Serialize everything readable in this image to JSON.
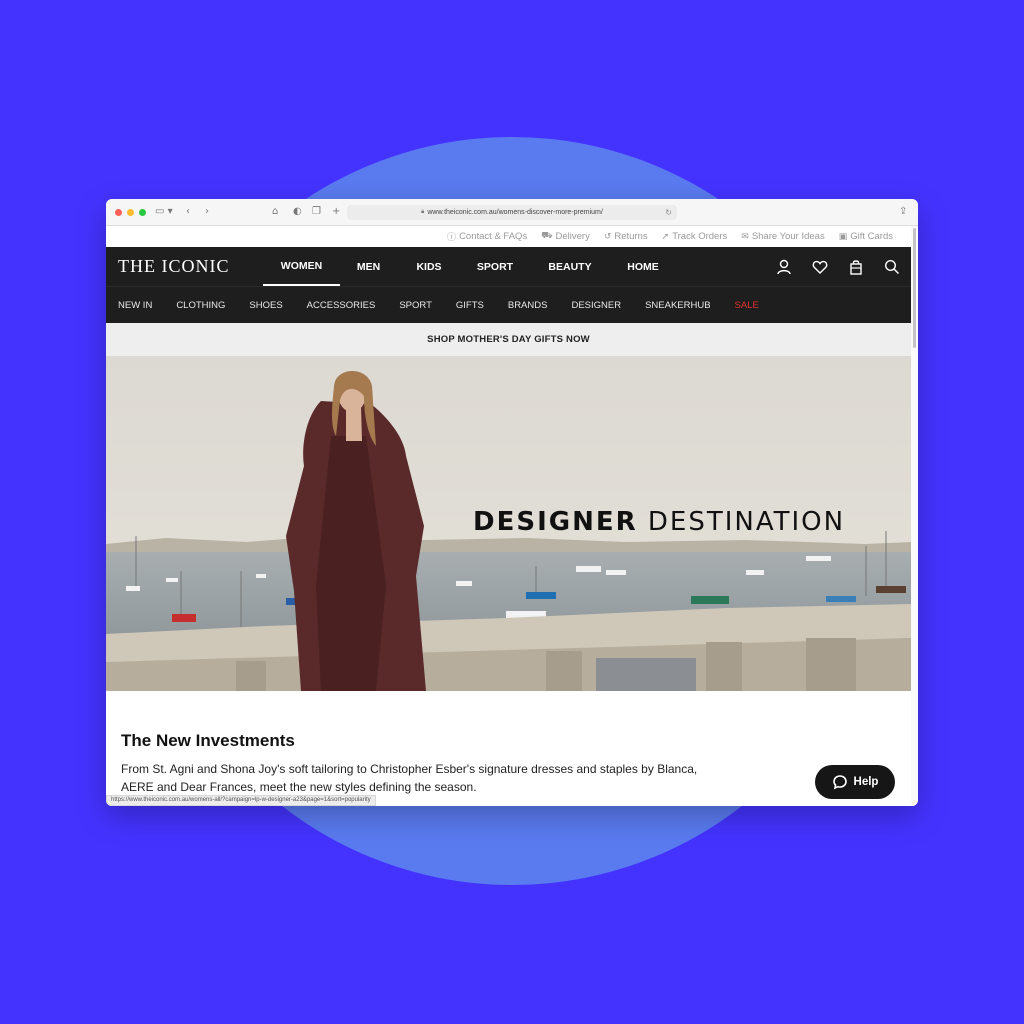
{
  "browser": {
    "url": "www.theiconic.com.au/womens-discover-more-premium/",
    "status_url": "https://www.theiconic.com.au/womens-all/?campaign=lp-w-designer-a23&page=1&sort=popularity"
  },
  "utility_links": [
    {
      "label": "Contact & FAQs",
      "icon": "help-circle-icon"
    },
    {
      "label": "Delivery",
      "icon": "truck-icon"
    },
    {
      "label": "Returns",
      "icon": "return-icon"
    },
    {
      "label": "Track Orders",
      "icon": "send-icon"
    },
    {
      "label": "Share Your Ideas",
      "icon": "megaphone-icon"
    },
    {
      "label": "Gift Cards",
      "icon": "gift-card-icon"
    }
  ],
  "header": {
    "logo": "THE ICONIC",
    "tabs": [
      "WOMEN",
      "MEN",
      "KIDS",
      "SPORT",
      "BEAUTY",
      "HOME"
    ],
    "active_tab": "WOMEN",
    "icons": [
      "account-icon",
      "wishlist-heart-icon",
      "shopping-bag-icon",
      "search-icon"
    ]
  },
  "subnav": [
    "NEW IN",
    "CLOTHING",
    "SHOES",
    "ACCESSORIES",
    "SPORT",
    "GIFTS",
    "BRANDS",
    "DESIGNER",
    "SNEAKERHUB",
    "SALE"
  ],
  "promo_text": "SHOP MOTHER'S DAY GIFTS NOW",
  "hero": {
    "title_bold": "DESIGNER",
    "title_light": "DESTINATION"
  },
  "section": {
    "title": "The New Investments",
    "body": "From St. Agni and Shona Joy's soft tailoring to Christopher Esber's signature dresses and staples by Blanca, AERE and Dear Frances, meet the new styles defining the season."
  },
  "help_button": "Help",
  "colors": {
    "background": "#4433ff",
    "circle": "#5a7bf0",
    "nav": "#1e1e1e",
    "sale": "#e3312c"
  }
}
